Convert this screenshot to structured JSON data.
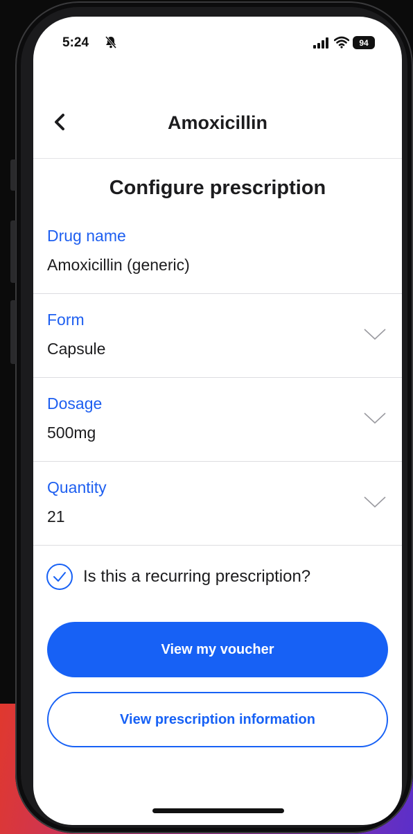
{
  "status_bar": {
    "time": "5:24",
    "battery": "94",
    "icons": [
      "bell-slash-icon",
      "signal-icon",
      "wifi-icon",
      "battery-icon"
    ]
  },
  "nav": {
    "title": "Amoxicillin",
    "back_icon": "chevron-left-icon"
  },
  "section": {
    "title": "Configure prescription"
  },
  "fields": [
    {
      "label": "Drug name",
      "value": "Amoxicillin (generic)"
    },
    {
      "label": "Form",
      "value": "Capsule"
    },
    {
      "label": "Dosage",
      "value": "500mg"
    },
    {
      "label": "Quantity",
      "value": "21"
    }
  ],
  "recurring": {
    "label": "Is this a recurring prescription?",
    "checked": true
  },
  "buttons": {
    "primary": "View my voucher",
    "secondary": "View prescription information"
  },
  "colors": {
    "accent": "#1761f5",
    "label_blue": "#1e5ff0",
    "text": "#1c1c1e",
    "divider": "#dcdce0"
  }
}
